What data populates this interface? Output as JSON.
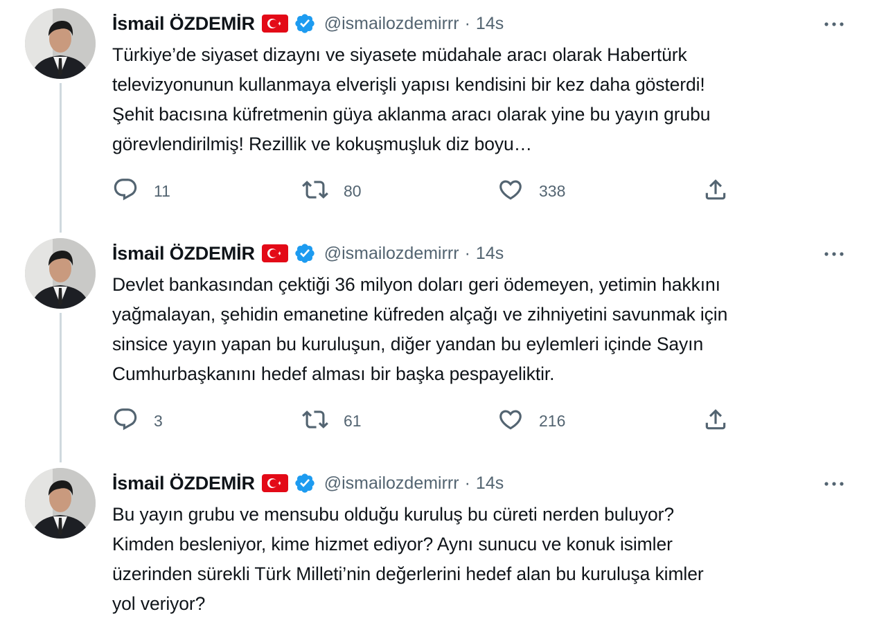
{
  "tweets": [
    {
      "author": {
        "name": "İsmail ÖZDEMİR",
        "handle": "@ismailozdemirrr",
        "separator": "·",
        "time": "14s"
      },
      "lines": [
        "Türkiye’de siyaset dizaynı ve siyasete müdahale aracı olarak Habertürk",
        "televizyonunun kullanmaya elverişli yapısı kendisini bir kez daha gösterdi!",
        "Şehit bacısına küfretmenin güya aklanma aracı olarak yine bu yayın grubu",
        "görevlendirilmiş! Rezillik ve kokuşmuşluk diz boyu…"
      ],
      "stats": {
        "replies": "11",
        "retweets": "80",
        "likes": "338"
      }
    },
    {
      "author": {
        "name": "İsmail ÖZDEMİR",
        "handle": "@ismailozdemirrr",
        "separator": "·",
        "time": "14s"
      },
      "lines": [
        "Devlet bankasından çektiği 36 milyon doları geri ödemeyen, yetimin hakkını",
        "yağmalayan, şehidin emanetine küfreden alçağı ve zihniyetini savunmak için",
        "sinsice yayın yapan bu kuruluşun, diğer yandan bu eylemleri içinde Sayın",
        "Cumhurbaşkanını hedef alması bir başka pespayeliktir."
      ],
      "stats": {
        "replies": "3",
        "retweets": "61",
        "likes": "216"
      }
    },
    {
      "author": {
        "name": "İsmail ÖZDEMİR",
        "handle": "@ismailozdemirrr",
        "separator": "·",
        "time": "14s"
      },
      "lines": [
        "Bu yayın grubu ve mensubu olduğu kuruluş bu cüreti nerden buluyor?",
        "Kimden besleniyor, kime hizmet ediyor? Aynı sunucu ve konuk isimler",
        "üzerinden sürekli Türk Milleti’nin değerlerini hedef alan bu kuruluşa kimler",
        "yol veriyor?"
      ]
    }
  ],
  "icons": {
    "flag": "turkey-flag-icon",
    "verified": "verified-badge-icon",
    "more": "more-options-icon",
    "reply": "reply-icon",
    "retweet": "retweet-icon",
    "like": "like-icon",
    "share": "share-icon"
  },
  "colors": {
    "text": "#0f1419",
    "secondary": "#536471",
    "verified": "#1d9bf0",
    "flag_red": "#e30a17",
    "thread_line": "#cfd9de"
  }
}
